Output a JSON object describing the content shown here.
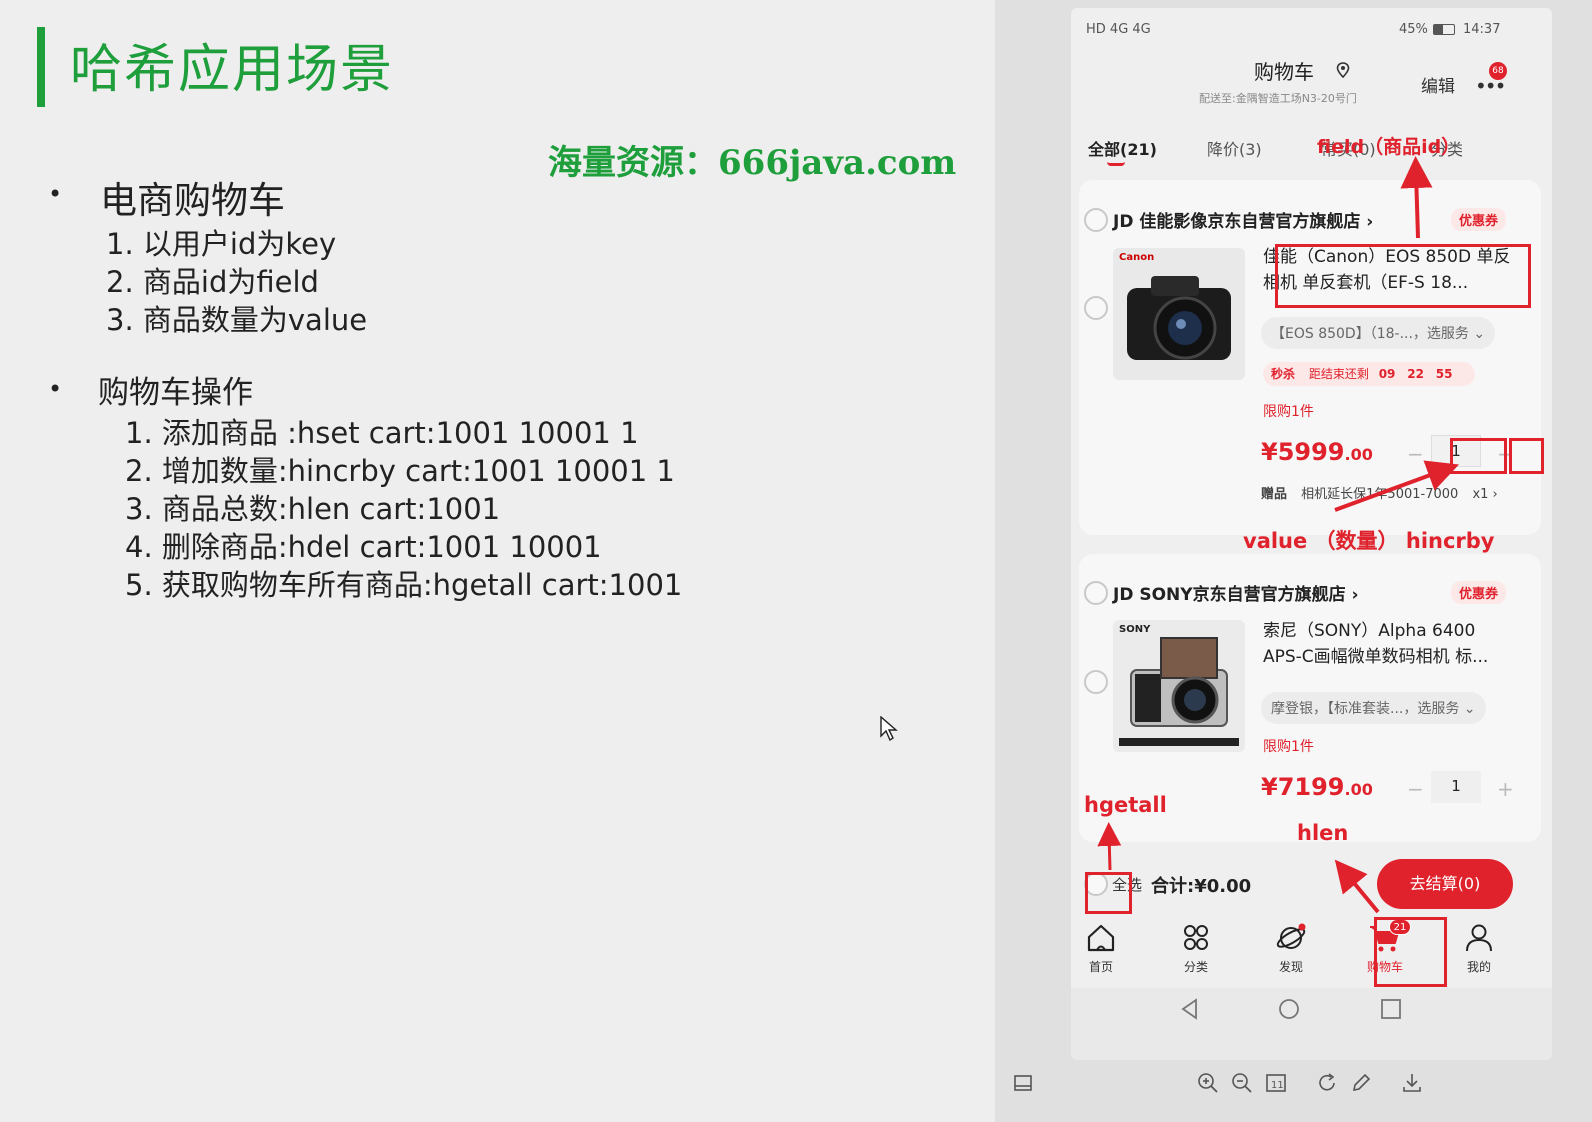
{
  "slide": {
    "title": "哈希应用场景",
    "watermark": "海量资源：666java.com",
    "section1": {
      "bullet": "•",
      "title": "电商购物车",
      "items": [
        "1. 以用户id为key",
        "2. 商品id为field",
        "3. 商品数量为value"
      ]
    },
    "section2": {
      "bullet": "•",
      "title": "购物车操作",
      "items": [
        "1. 添加商品 :hset cart:1001 10001 1",
        "2. 增加数量:hincrby cart:1001 10001 1",
        "3. 商品总数:hlen cart:1001",
        "4. 删除商品:hdel cart:1001 10001",
        "5. 获取购物车所有商品:hgetall cart:1001"
      ]
    }
  },
  "phone": {
    "status": {
      "left": "HD 4G 4G",
      "battery": "45%",
      "time": "14:37"
    },
    "header": {
      "title": "购物车",
      "address": "配送至:金隅智造工场N3-20号门",
      "edit": "编辑",
      "badge": "68"
    },
    "tabs": [
      "全部(21)",
      "降价(3)",
      "常买(0)",
      "分类"
    ],
    "annotations": {
      "field": "field（商品id）",
      "value": "value （数量） hincrby",
      "hgetall": "hgetall",
      "hlen": "hlen"
    },
    "shops": [
      {
        "name": "JD 佳能影像京东自营官方旗舰店 ›",
        "coupon": "优惠券",
        "brand": "Canon",
        "product": "佳能（Canon）EOS 850D 单反相机 单反套机（EF-S 18...",
        "spec": "【EOS 850D】（18-...，选服务 ⌄",
        "flash": "秒杀",
        "countdown_label": "距结束还剩",
        "countdown": [
          "09",
          "22",
          "55"
        ],
        "limit": "限购1件",
        "price": "¥5999",
        "price_decimal": ".00",
        "qty": "1",
        "gift_label": "赠品",
        "gift": "相机延长保1年5001-7000",
        "gift_qty": "x1 ›"
      },
      {
        "name": "JD SONY京东自营官方旗舰店 ›",
        "coupon": "优惠券",
        "brand": "SONY",
        "product": "索尼（SONY）Alpha 6400 APS-C画幅微单数码相机 标...",
        "spec": "摩登银，【标准套装...，选服务 ⌄",
        "limit": "限购1件",
        "price": "¥7199",
        "price_decimal": ".00",
        "qty": "1"
      }
    ],
    "footer": {
      "select_all": "全选",
      "total": "合计:¥0.00",
      "checkout": "去结算(0)"
    },
    "nav": [
      {
        "label": "首页",
        "icon": "home-icon"
      },
      {
        "label": "分类",
        "icon": "category-icon"
      },
      {
        "label": "发现",
        "icon": "discover-icon"
      },
      {
        "label": "购物车",
        "icon": "cart-icon",
        "badge": "21"
      },
      {
        "label": "我的",
        "icon": "user-icon"
      }
    ]
  },
  "viewer_toolbar": [
    "zoom-in-icon",
    "zoom-out-icon",
    "fit-icon",
    "rotate-icon",
    "edit-icon",
    "download-icon"
  ],
  "colors": {
    "slide_green": "#1f9f3c",
    "jd_red": "#e0222d"
  }
}
